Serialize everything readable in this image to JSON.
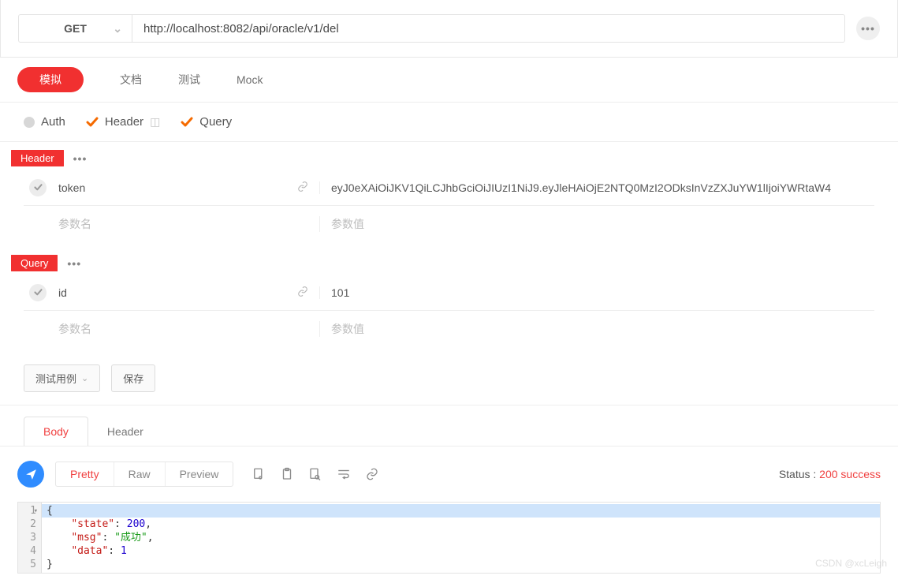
{
  "request": {
    "method": "GET",
    "url": "http://localhost:8082/api/oracle/v1/del"
  },
  "main_tabs": {
    "mock_label": "模拟",
    "doc_label": "文档",
    "test_label": "测试",
    "mockapi_label": "Mock"
  },
  "sub_tabs": {
    "auth": "Auth",
    "header": "Header",
    "query": "Query"
  },
  "sections": {
    "header_label": "Header",
    "query_label": "Query",
    "placeholders": {
      "name": "参数名",
      "value": "参数值"
    },
    "header_rows": [
      {
        "name": "token",
        "value": "eyJ0eXAiOiJKV1QiLCJhbGciOiJIUzI1NiJ9.eyJleHAiOjE2NTQ0MzI2ODksInVzZXJuYW1lIjoiYWRtaW4"
      }
    ],
    "query_rows": [
      {
        "name": "id",
        "value": "101"
      }
    ]
  },
  "buttons": {
    "testcase": "测试用例",
    "save": "保存"
  },
  "response": {
    "tabs": {
      "body": "Body",
      "header": "Header"
    },
    "view_tabs": {
      "pretty": "Pretty",
      "raw": "Raw",
      "preview": "Preview"
    },
    "status_label": "Status :",
    "status_value": "200 success",
    "json": {
      "state_key": "\"state\"",
      "state_val": "200",
      "msg_key": "\"msg\"",
      "msg_val": "\"成功\"",
      "data_key": "\"data\"",
      "data_val": "1"
    },
    "line_nums": [
      "1",
      "2",
      "3",
      "4",
      "5"
    ]
  },
  "watermark": "CSDN @xcLeigh"
}
